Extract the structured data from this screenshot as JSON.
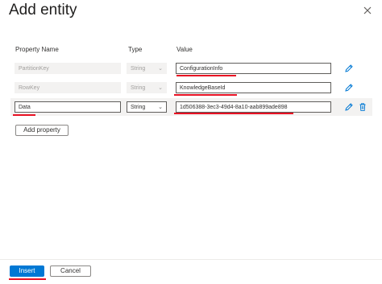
{
  "dialog": {
    "title": "Add entity"
  },
  "columns": {
    "name": "Property Name",
    "type": "Type",
    "value": "Value"
  },
  "rows": [
    {
      "name": "PartitionKey",
      "type": "String",
      "value": "ConfigurationInfo"
    },
    {
      "name": "RowKey",
      "type": "String",
      "value": "KnowledgeBaseId"
    },
    {
      "name": "Data",
      "type": "String",
      "value": "1d506388-3ec3-49d4-8a10-aab899ade898"
    }
  ],
  "add_property_label": "Add property",
  "footer": {
    "insert_label": "Insert",
    "cancel_label": "Cancel"
  },
  "colors": {
    "accent": "#0078d4",
    "highlight": "#e81123"
  },
  "icons": {
    "close": "close-icon",
    "edit": "pencil-icon",
    "delete": "trash-icon",
    "dropdown": "chevron-down-icon"
  }
}
